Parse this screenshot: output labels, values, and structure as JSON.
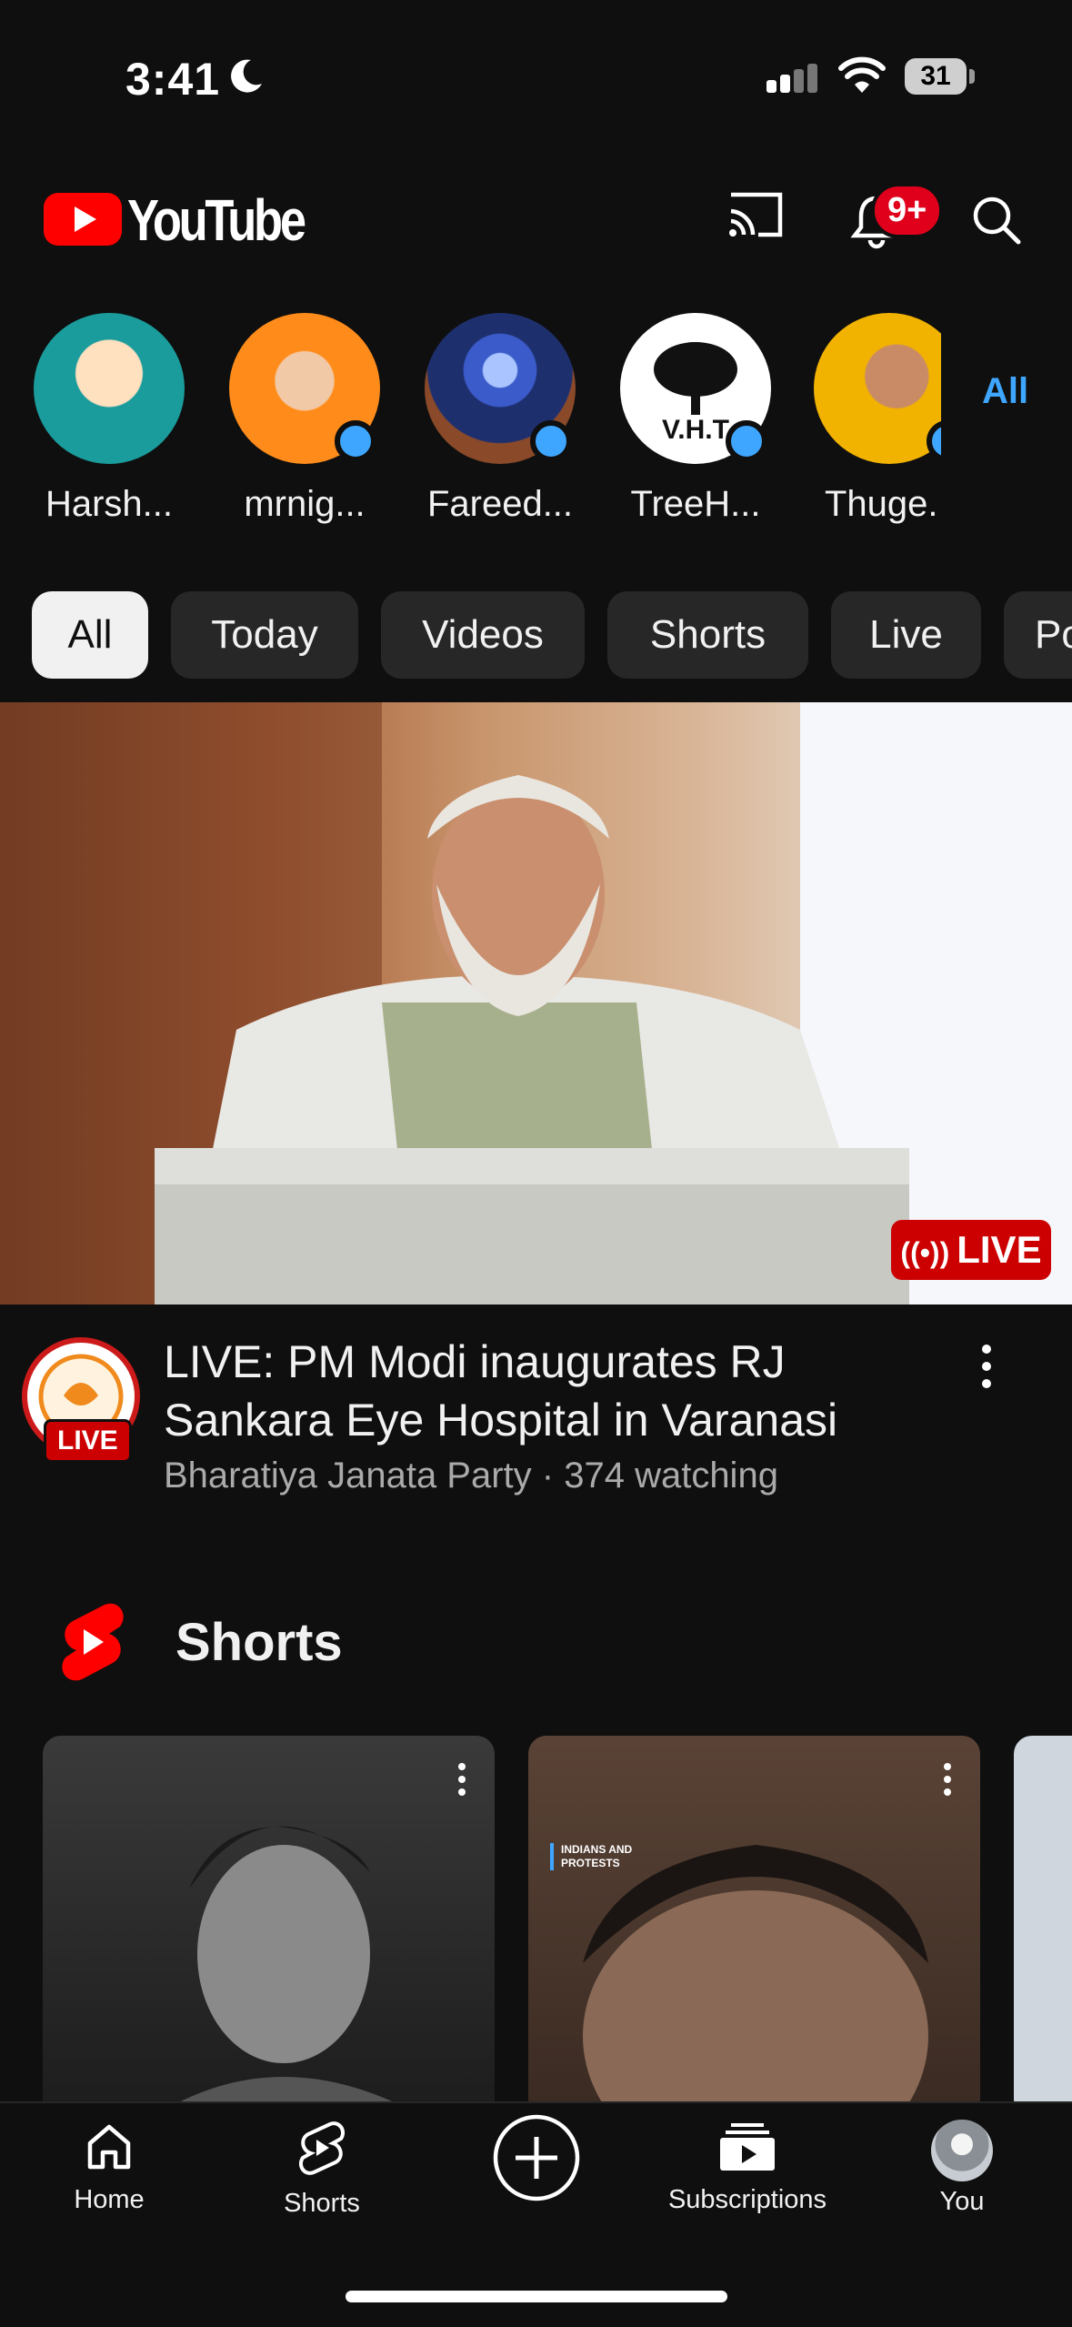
{
  "status": {
    "time": "3:41",
    "battery": "31"
  },
  "header": {
    "app_name": "YouTube",
    "notification_count": "9+"
  },
  "channels": {
    "items": [
      {
        "name": "Harsh...",
        "new": false,
        "color": "#1aa0a0"
      },
      {
        "name": "mrnig...",
        "new": true,
        "color": "#ff8c1a"
      },
      {
        "name": "Fareed...",
        "new": true,
        "color": "#1e3a8a"
      },
      {
        "name": "TreeH...",
        "new": true,
        "color": "#ffffff"
      },
      {
        "name": "Thuge.",
        "new": true,
        "color": "#f2b200"
      }
    ],
    "all_label": "All"
  },
  "chips": [
    "All",
    "Today",
    "Videos",
    "Shorts",
    "Live",
    "Po"
  ],
  "video": {
    "title": "LIVE: PM Modi inaugurates RJ Sankara Eye Hospital in Varanasi",
    "meta": "Bharatiya Janata Party · 374 watching",
    "live_label": "LIVE",
    "channel_live_label": "LIVE"
  },
  "shorts": {
    "section_title": "Shorts",
    "card2_caption": "INDIANS AND PROTESTS"
  },
  "nav": {
    "home": "Home",
    "shorts": "Shorts",
    "subscriptions": "Subscriptions",
    "you": "You"
  },
  "colors": {
    "brand_red": "#ff0000",
    "accent_blue": "#3ea6ff",
    "live_red": "#cc0000"
  }
}
